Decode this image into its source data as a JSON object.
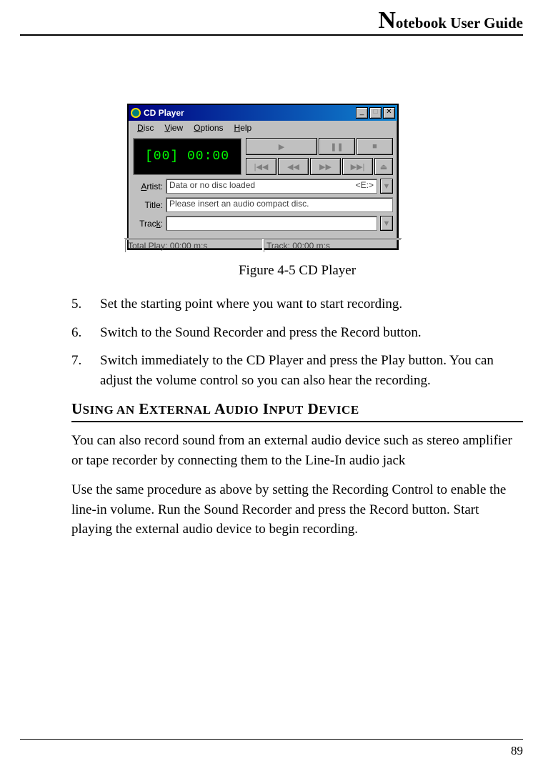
{
  "header": {
    "title_big": "N",
    "title_rest": "otebook User Guide"
  },
  "cd": {
    "window_title": "CD Player",
    "menus": {
      "disc": "Disc",
      "view": "View",
      "options": "Options",
      "help": "Help"
    },
    "display": "[00] 00:00",
    "labels": {
      "artist": "Artist:",
      "title": "Title:",
      "track": "Track:"
    },
    "artist_value": "Data or no disc loaded",
    "artist_drive": "<E:>",
    "title_value": "Please insert an audio compact disc.",
    "track_value": "",
    "status": {
      "total": "Total Play: 00:00 m:s",
      "track": "Track: 00:00 m:s"
    }
  },
  "caption": "Figure 4-5   CD Player",
  "steps": [
    {
      "n": "5.",
      "text": "Set the starting point where you want to start recording."
    },
    {
      "n": "6.",
      "text": "Switch to the Sound Recorder and press the Record button."
    },
    {
      "n": "7.",
      "text": "Switch immediately to the CD Player and press the Play button. You can adjust the volume control so you can also hear the recording."
    }
  ],
  "section_heading": "Using an External Audio Input Device",
  "para1": "You can also record sound from an external audio device such as stereo amplifier or tape recorder by connecting them to the Line-In audio jack",
  "para2": "Use the same procedure as above by setting the Recording Control to enable the line-in volume. Run the Sound Recorder and press the Record button. Start playing the external audio device to begin recording.",
  "page_number": "89"
}
